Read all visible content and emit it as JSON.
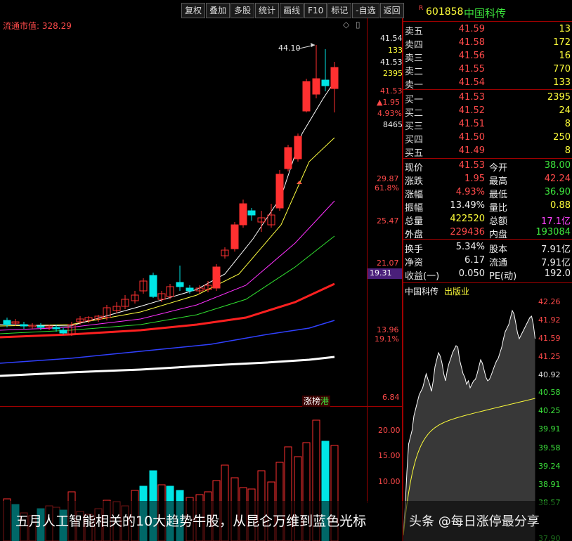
{
  "toolbar": {
    "buttons": [
      "复权",
      "叠加",
      "多股",
      "统计",
      "画线",
      "F10",
      "标记",
      "-自选",
      "返回"
    ]
  },
  "ticker": {
    "flag": "R",
    "code": "601858",
    "name": "中国科传"
  },
  "kline": {
    "circulating_cap_label": "流通市值: 328.29",
    "peak_label": "44.10",
    "price_axis": [
      "29.87",
      "25.47",
      "21.07",
      "13.96",
      "6.84"
    ],
    "pct_axis": [
      "61.8%",
      "19.1%"
    ],
    "current_tag": "19.31",
    "mini_quote": [
      "41.54",
      "133",
      "41.53",
      "2395",
      "41.53",
      "▲1.95",
      "4.93%",
      "8465"
    ],
    "badge_text": "涨",
    "badge_text2": "榜",
    "badge_text3": "港",
    "volume_axis": [
      "20.00",
      "15.00",
      "10.00"
    ]
  },
  "order_book": {
    "asks": [
      {
        "label": "卖五",
        "price": "41.59",
        "vol": "13"
      },
      {
        "label": "卖四",
        "price": "41.58",
        "vol": "172"
      },
      {
        "label": "卖三",
        "price": "41.56",
        "vol": "16"
      },
      {
        "label": "卖二",
        "price": "41.55",
        "vol": "770"
      },
      {
        "label": "卖一",
        "price": "41.54",
        "vol": "133"
      }
    ],
    "bids": [
      {
        "label": "买一",
        "price": "41.53",
        "vol": "2395"
      },
      {
        "label": "买二",
        "price": "41.52",
        "vol": "24"
      },
      {
        "label": "买三",
        "price": "41.51",
        "vol": "8"
      },
      {
        "label": "买四",
        "price": "41.50",
        "vol": "250"
      },
      {
        "label": "买五",
        "price": "41.49",
        "vol": "8"
      }
    ]
  },
  "stats": {
    "r1": {
      "a": "现价",
      "av": "41.53",
      "b": "今开",
      "bv": "38.00"
    },
    "r2": {
      "a": "涨跌",
      "av": "1.95",
      "b": "最高",
      "bv": "42.24"
    },
    "r3": {
      "a": "涨幅",
      "av": "4.93%",
      "b": "最低",
      "bv": "36.90"
    },
    "r4": {
      "a": "振幅",
      "av": "13.49%",
      "b": "量比",
      "bv": "0.88"
    },
    "r5": {
      "a": "总量",
      "av": "422520",
      "b": "总额",
      "bv": "17.1亿"
    },
    "r6": {
      "a": "外盘",
      "av": "229436",
      "b": "内盘",
      "bv": "193084"
    },
    "r7": {
      "a": "换手",
      "av": "5.34%",
      "b": "股本",
      "bv": "7.91亿"
    },
    "r8": {
      "a": "净资",
      "av": "6.17",
      "b": "流通",
      "bv": "7.91亿"
    },
    "r9": {
      "a": "收益(一)",
      "av": "0.050",
      "b": "PE(动)",
      "bv": "192.0"
    }
  },
  "intraday": {
    "title": "中国科传",
    "sector": "出版业",
    "price_axis": [
      "42.26",
      "41.92",
      "41.59",
      "41.25",
      "40.92",
      "40.58",
      "40.25",
      "39.91",
      "39.58",
      "39.24",
      "38.91",
      "38.57",
      "37.90"
    ]
  },
  "caption": {
    "text": "五月人工智能相关的10大趋势牛股，从昆仑万维到蓝色光标",
    "watermark": "头条 @每日涨停最分享"
  },
  "colors": {
    "up": "#ff3030",
    "down": "#00e5e5",
    "divider": "#a00000"
  }
}
